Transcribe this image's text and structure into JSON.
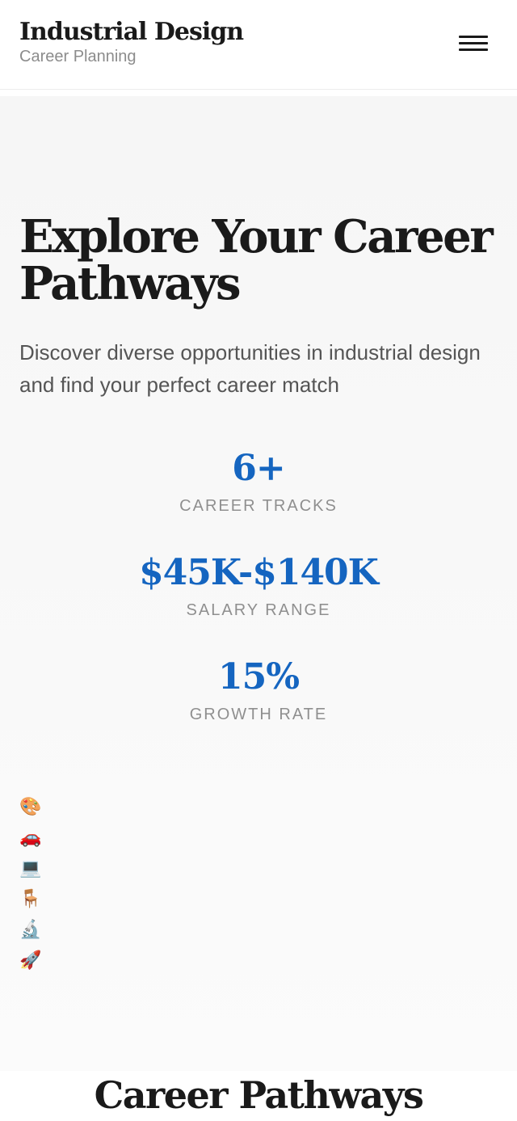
{
  "header": {
    "brand_title": "Industrial Design",
    "brand_subtitle": "Career Planning",
    "menu_icon": "hamburger-menu-icon"
  },
  "hero": {
    "title": "Explore Your Career Pathways",
    "description": "Discover diverse opportunities in industrial design and find your perfect career match"
  },
  "stats": [
    {
      "value": "6+",
      "label": "CAREER TRACKS"
    },
    {
      "value": "$45K-$140K",
      "label": "SALARY RANGE"
    },
    {
      "value": "15%",
      "label": "GROWTH RATE"
    }
  ],
  "icons": [
    {
      "name": "palette-icon",
      "glyph": "🎨"
    },
    {
      "name": "car-icon",
      "glyph": "🚗"
    },
    {
      "name": "laptop-icon",
      "glyph": "💻"
    },
    {
      "name": "chair-icon",
      "glyph": "🪑"
    },
    {
      "name": "microscope-icon",
      "glyph": "🔬"
    },
    {
      "name": "rocket-icon",
      "glyph": "🚀"
    }
  ],
  "section": {
    "title": "Career Pathways"
  },
  "colors": {
    "accent": "#1565c0",
    "text": "#1a1a1a",
    "muted": "#8f8f8f"
  }
}
